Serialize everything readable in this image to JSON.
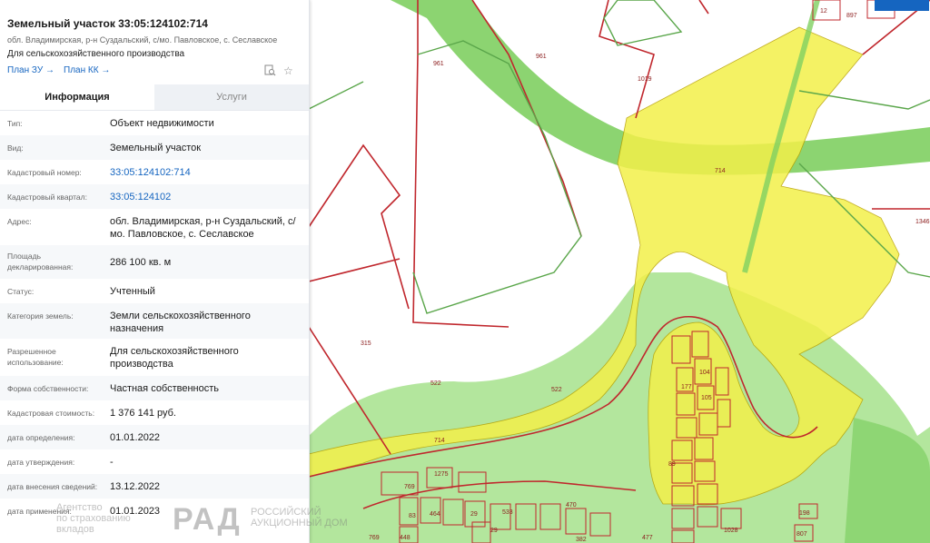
{
  "panel": {
    "title": "Земельный участок 33:05:124102:714",
    "address_short": "обл. Владимирская, р-н Суздальский, с/мо. Павловское, с. Сеславское",
    "purpose": "Для сельскохозяйственного производства",
    "links": [
      {
        "label": "План ЗУ"
      },
      {
        "label": "План КК"
      }
    ],
    "tools": [
      {
        "icon": "search-doc-icon"
      },
      {
        "icon": "star-icon"
      }
    ],
    "tabs": [
      {
        "label": "Информация",
        "active": true
      },
      {
        "label": "Услуги",
        "active": false
      }
    ],
    "rows": [
      {
        "label": "Тип:",
        "value": "Объект недвижимости"
      },
      {
        "label": "Вид:",
        "value": "Земельный участок"
      },
      {
        "label": "Кадастровый номер:",
        "value": "33:05:124102:714",
        "link": true
      },
      {
        "label": "Кадастровый квартал:",
        "value": "33:05:124102",
        "link": true
      },
      {
        "label": "Адрес:",
        "value": "обл. Владимирская, р-н Суздальский, с/мо. Павловское, с. Сеславское"
      },
      {
        "label": "Площадь декларированная:",
        "value": "286 100 кв. м"
      },
      {
        "label": "Статус:",
        "value": "Учтенный"
      },
      {
        "label": "Категория земель:",
        "value": "Земли сельскохозяйственного назначения"
      },
      {
        "label": "Разрешенное использование:",
        "value": "Для сельскохозяйственного производства"
      },
      {
        "label": "Форма собственности:",
        "value": "Частная собственность"
      },
      {
        "label": "Кадастровая стоимость:",
        "value": "1 376 141 руб."
      },
      {
        "label": "дата определения:",
        "value": "01.01.2022"
      },
      {
        "label": "дата утверждения:",
        "value": "-"
      },
      {
        "label": "дата внесения сведений:",
        "value": "13.12.2022"
      },
      {
        "label": "дата применения:",
        "value": "01.01.2023"
      }
    ]
  },
  "watermark": {
    "left_lines": [
      "Агентство",
      "по страхованию",
      "вкладов"
    ],
    "logo_text": "РАД",
    "right_lines": [
      "РОССИЙСКИЙ",
      "АУКЦИОННЫЙ ДОМ"
    ]
  },
  "map": {
    "labels": [
      "961",
      "961",
      "1019",
      "714",
      "1346",
      "315",
      "522",
      "522",
      "714",
      "104",
      "177",
      "105",
      "89",
      "1275",
      "769",
      "83",
      "464",
      "533",
      "470",
      "29",
      "29",
      "448",
      "769",
      "382",
      "477",
      "1028",
      "198",
      "807",
      "12",
      "897"
    ]
  },
  "colors": {
    "link": "#1565c0",
    "parcel_fill": "#f3f04a",
    "forest_light": "#a6e28c",
    "forest_dark": "#7fcf62",
    "boundary_red": "#c0272d"
  }
}
